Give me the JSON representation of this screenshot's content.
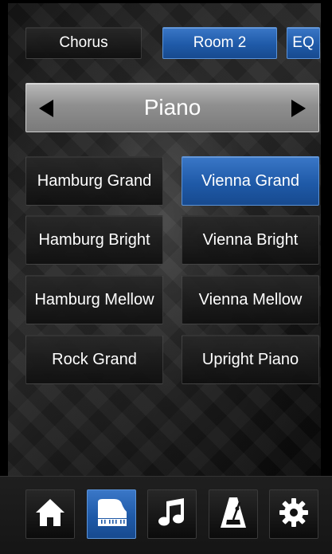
{
  "top_bar": {
    "chorus_label": "Chorus",
    "room_label": "Room 2",
    "eq_label": "EQ"
  },
  "category_selector": {
    "title": "Piano",
    "prev_icon": "triangle-left-icon",
    "next_icon": "triangle-right-icon"
  },
  "voices": [
    {
      "label": "Hamburg Grand",
      "selected": false
    },
    {
      "label": "Vienna Grand",
      "selected": true
    },
    {
      "label": "Hamburg Bright",
      "selected": false
    },
    {
      "label": "Vienna Bright",
      "selected": false
    },
    {
      "label": "Hamburg Mellow",
      "selected": false
    },
    {
      "label": "Vienna Mellow",
      "selected": false
    },
    {
      "label": "Rock Grand",
      "selected": false
    },
    {
      "label": "Upright Piano",
      "selected": false
    }
  ],
  "bottom_nav": [
    {
      "icon": "home-icon",
      "active": false
    },
    {
      "icon": "grand-piano-icon",
      "active": true
    },
    {
      "icon": "music-note-icon",
      "active": false
    },
    {
      "icon": "metronome-icon",
      "active": false
    },
    {
      "icon": "gear-icon",
      "active": false
    }
  ],
  "colors": {
    "accent_blue": "#1f5aa8",
    "selector_gray": "#9a9a9a",
    "background": "#1a1a1a"
  }
}
